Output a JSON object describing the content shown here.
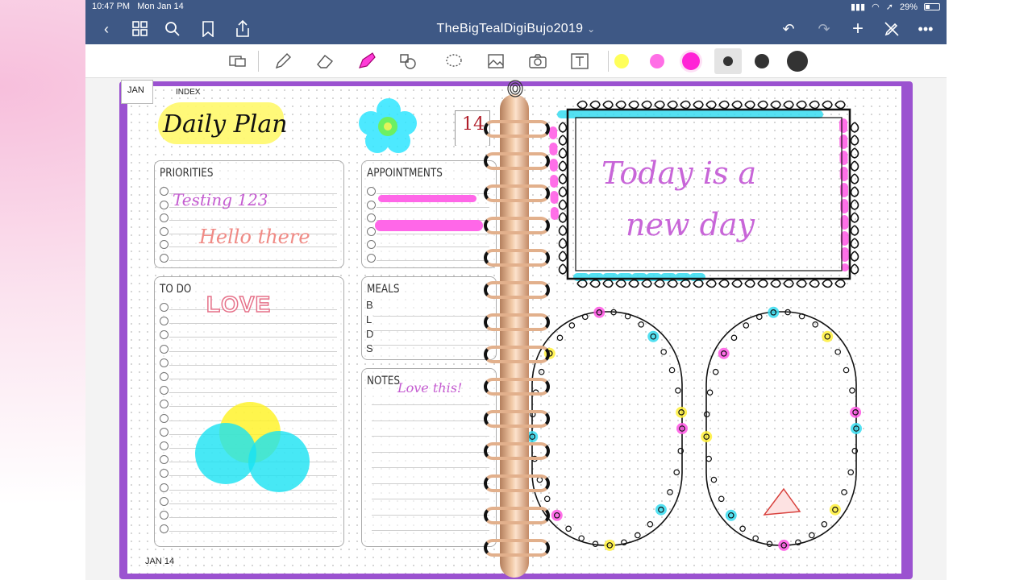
{
  "status_bar": {
    "time": "10:47 PM",
    "date": "Mon Jan 14",
    "battery": "29%"
  },
  "nav": {
    "title": "TheBigTealDigiBujo2019",
    "title_chevron": "⌄"
  },
  "toolbar": {
    "swatches": [
      "#ffff5a",
      "#ff6ee6",
      "#ff22d6"
    ],
    "pen_sizes": [
      "small",
      "medium",
      "large"
    ]
  },
  "left_page": {
    "month_tab": "JAN",
    "index_label": "INDEX",
    "title": "Daily Plan",
    "date_tag": "14",
    "footer_date": "JAN 14",
    "priorities": {
      "title": "PRIORITIES",
      "text1": "Testing 123",
      "text2": "Hello there"
    },
    "todo": {
      "title": "TO DO",
      "text": "LOVE"
    },
    "appointments": {
      "title": "APPOINTMENTS"
    },
    "meals": {
      "title": "MEALS",
      "rows": [
        "B",
        "L",
        "D",
        "S"
      ]
    },
    "notes": {
      "title": "NOTES",
      "text": "Love this!"
    }
  },
  "right_page": {
    "quote_line1": "Today is a",
    "quote_line2": "new day"
  }
}
